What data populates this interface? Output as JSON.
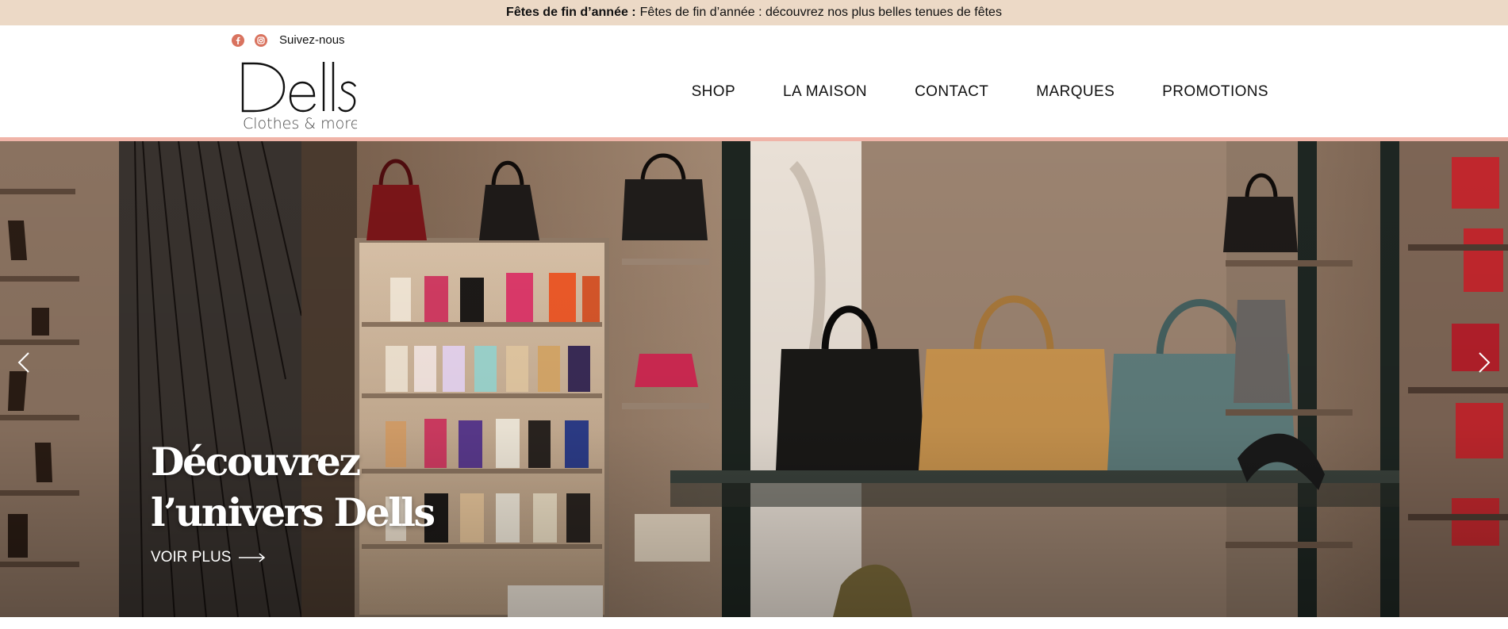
{
  "announcement": {
    "bold": "Fêtes de fin d’année :",
    "text": "Fêtes de fin d’année : découvrez nos plus belles tenues de fêtes"
  },
  "social": {
    "label": "Suivez-nous",
    "icons": [
      "facebook-icon",
      "instagram-icon"
    ]
  },
  "logo": {
    "name": "Dells",
    "tagline": "Clothes & more"
  },
  "nav": [
    "SHOP",
    "LA MAISON",
    "CONTACT",
    "MARQUES",
    "PROMOTIONS"
  ],
  "hero": {
    "title_line1": "Découvrez",
    "title_line2": "l’univers Dells",
    "cta": "VOIR PLUS"
  },
  "colors": {
    "announcement_bg": "#ecd9c6",
    "accent": "#f0b4a8",
    "social_icon": "#d9735f"
  }
}
